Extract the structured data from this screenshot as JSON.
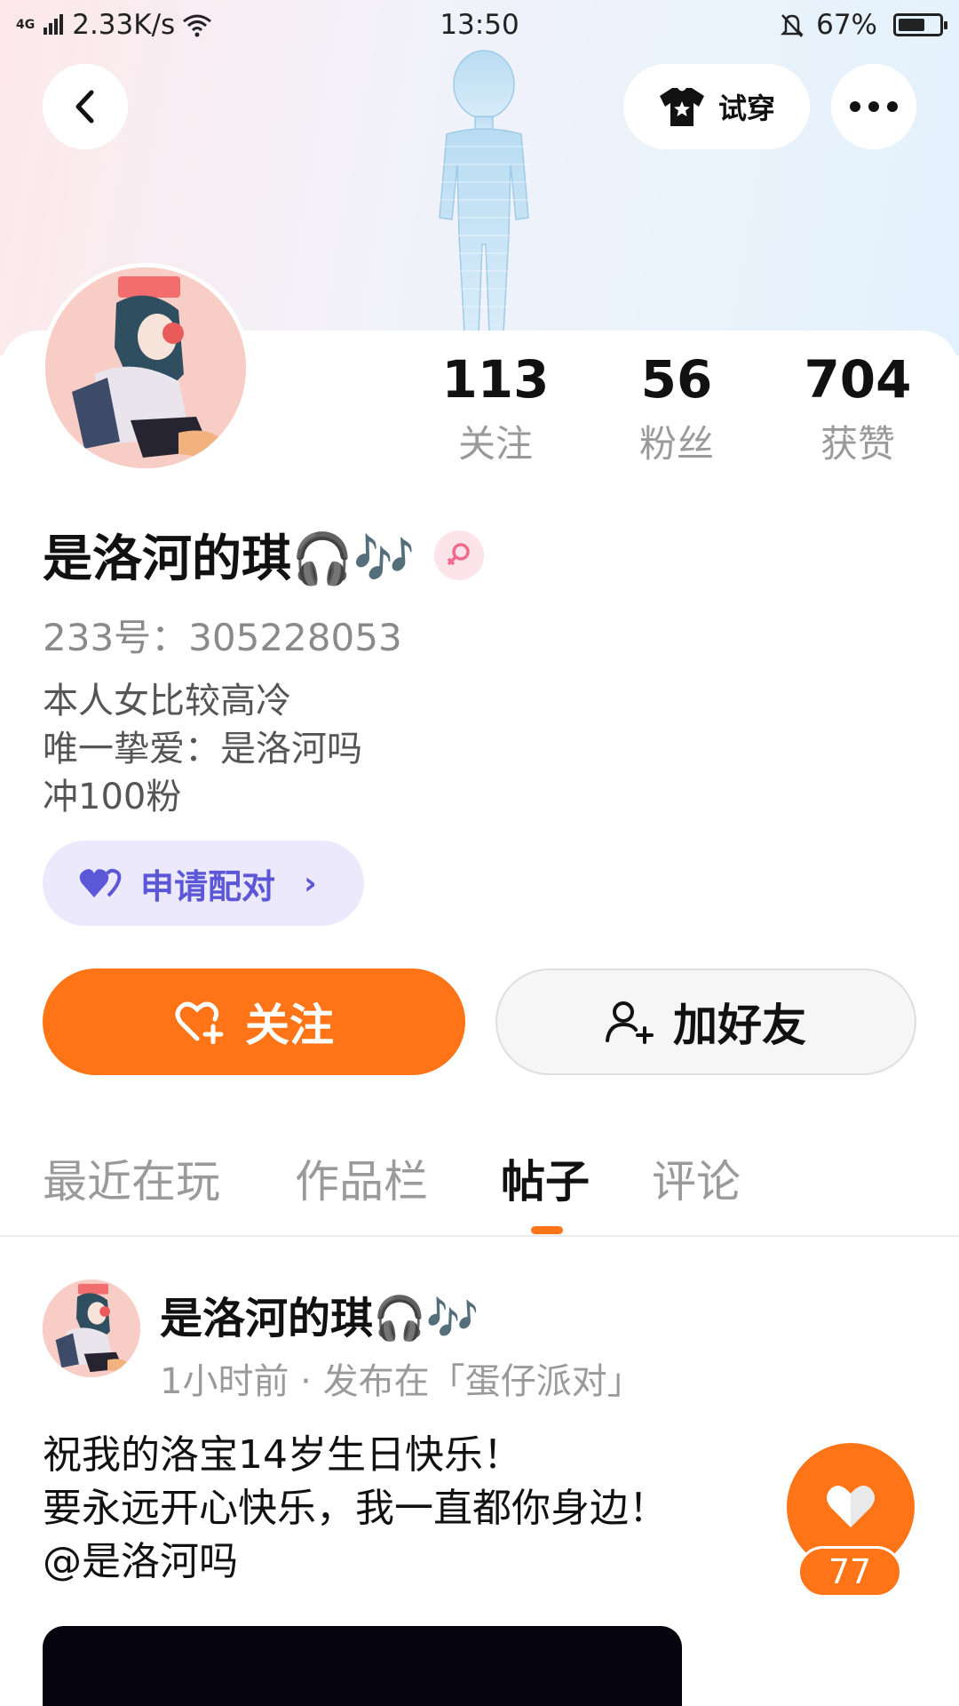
{
  "status_bar": {
    "network": "4G",
    "speed": "2.33K/s",
    "time": "13:50",
    "battery": "67%",
    "battery_level": 0.67
  },
  "header": {
    "back_icon": "chevron-left-icon",
    "try_on_label": "试穿",
    "try_on_icon": "shirt-star-icon",
    "more_icon": "more-dots-icon"
  },
  "profile": {
    "stats": [
      {
        "value": "113",
        "label": "关注"
      },
      {
        "value": "56",
        "label": "粉丝"
      },
      {
        "value": "704",
        "label": "获赞"
      }
    ],
    "nickname": "是洛河的琪🎧🎶",
    "gender_icon": "female-icon",
    "uid": "233号：305228053",
    "bio": [
      "本人女比较高冷",
      "唯一挚爱：是洛河吗",
      "冲100粉"
    ],
    "pair_label": "申请配对",
    "follow_label": "关注",
    "add_friend_label": "加好友"
  },
  "tabs": [
    {
      "label": "最近在玩",
      "active": false
    },
    {
      "label": "作品栏",
      "active": false
    },
    {
      "label": "帖子",
      "active": true
    },
    {
      "label": "评论",
      "active": false
    }
  ],
  "post": {
    "author": "是洛河的琪🎧🎶",
    "meta": "1小时前 · 发布在「蛋仔派对」",
    "lines": [
      "祝我的洛宝14岁生日快乐！",
      "要永远开心快乐，我一直都你身边！",
      "@是洛河吗"
    ],
    "like_count": "77"
  },
  "colors": {
    "accent": "#ff7416",
    "pair_purple": "#5b57d6",
    "pair_bg": "#ebe9fb"
  }
}
